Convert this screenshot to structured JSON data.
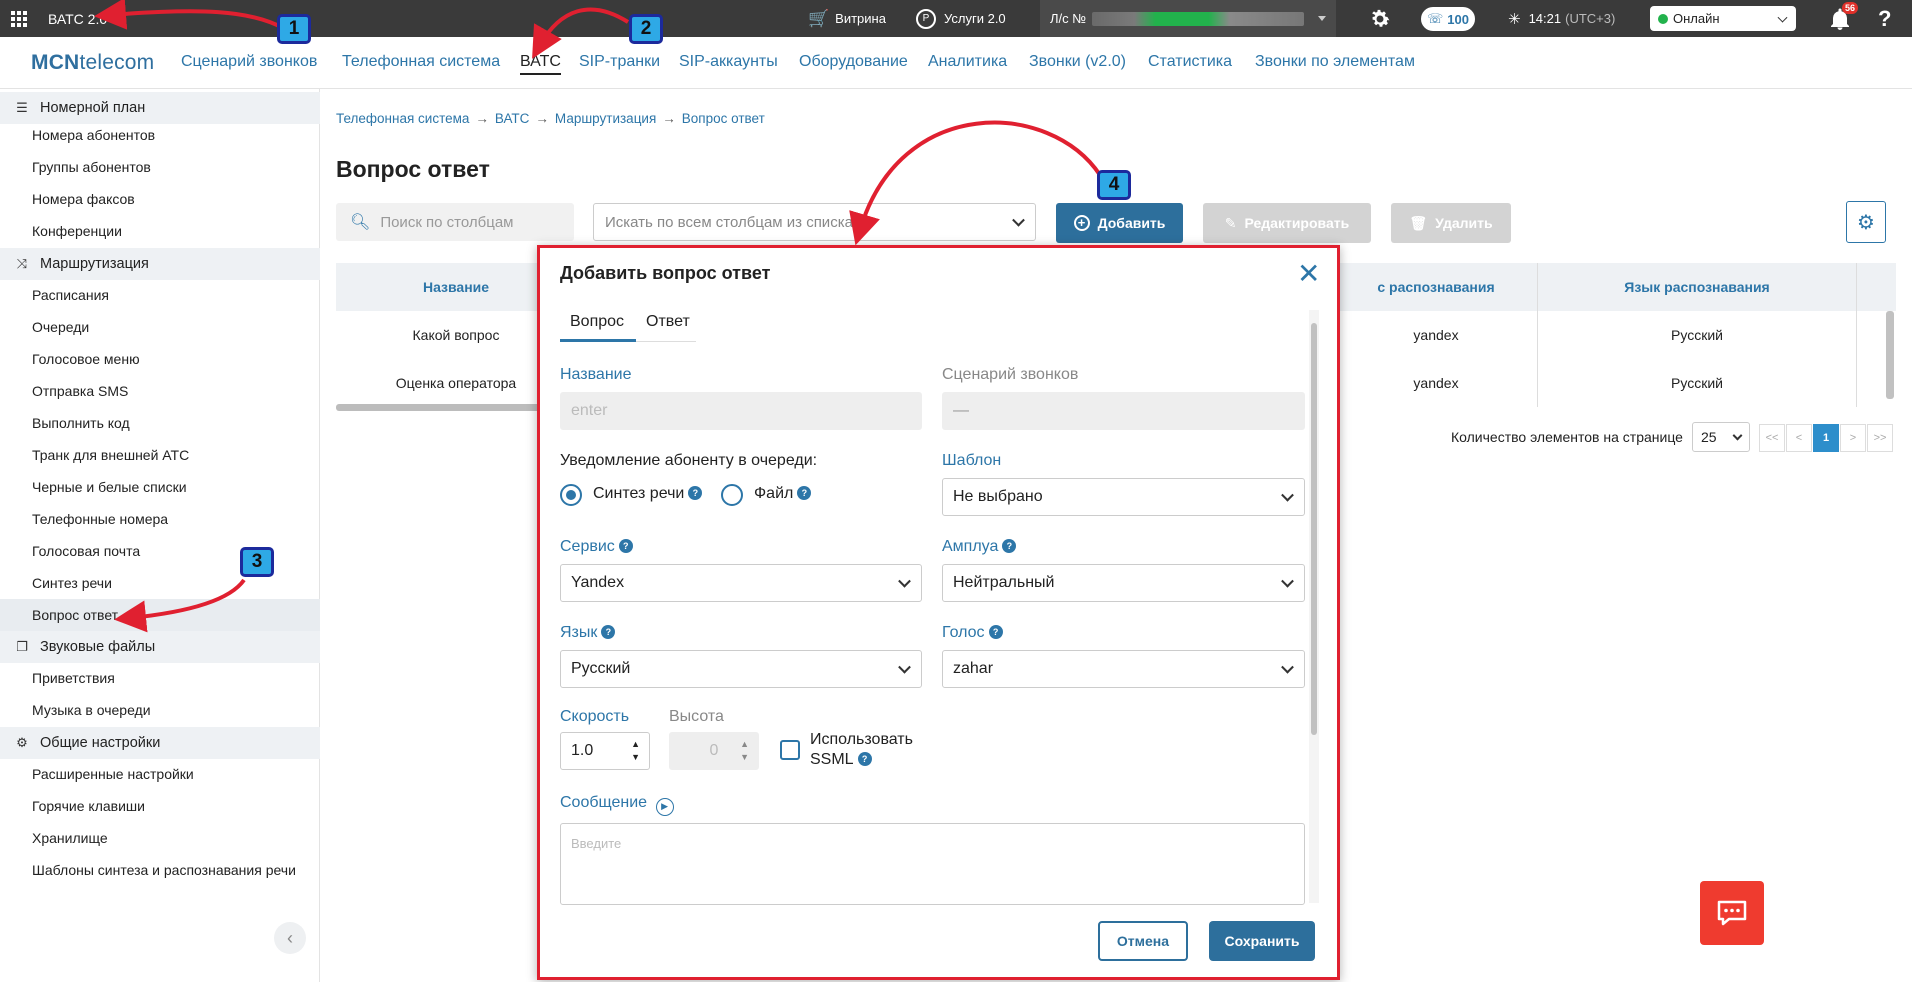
{
  "topbar": {
    "app_title": "ВАТС 2.0",
    "showcase_label": "Витрина",
    "services_label": "Услуги 2.0",
    "account_label": "Л/с №",
    "calls_count": "100",
    "time": "14:21",
    "timezone": "(UTC+3)",
    "status": "Онлайн",
    "notifications_count": "56"
  },
  "menu": {
    "logo_bold": "MCN",
    "logo_rest": "telecom",
    "items": [
      "Сценарий звонков",
      "Телефонная система",
      "ВАТС",
      "SIP-транки",
      "SIP-аккаунты",
      "Оборудование",
      "Аналитика",
      "Звонки (v2.0)",
      "Статистика",
      "Звонки по элементам"
    ],
    "active_index": 2
  },
  "sidebar": {
    "groups": [
      {
        "label": "Номерной план",
        "items": [
          "Номера абонентов",
          "Группы абонентов",
          "Номера факсов",
          "Конференции"
        ]
      },
      {
        "label": "Маршрутизация",
        "items": [
          "Расписания",
          "Очереди",
          "Голосовое меню",
          "Отправка SMS",
          "Выполнить код",
          "Транк для внешней АТС",
          "Черные и белые списки",
          "Телефонные номера",
          "Голосовая почта",
          "Синтез речи",
          "Вопрос ответ"
        ]
      },
      {
        "label": "Звуковые файлы",
        "items": [
          "Приветствия",
          "Музыка в очереди"
        ]
      },
      {
        "label": "Общие настройки",
        "items": [
          "Расширенные настройки",
          "Горячие клавиши",
          "Хранилище",
          "Шаблоны синтеза и распознавания речи"
        ]
      }
    ],
    "selected_item": "Вопрос ответ"
  },
  "breadcrumbs": [
    "Телефонная система",
    "ВАТС",
    "Маршрутизация",
    "Вопрос ответ"
  ],
  "page": {
    "title": "Вопрос ответ",
    "search_placeholder": "Поиск по столбцам",
    "column_search_placeholder": "Искать по всем столбцам из списка",
    "add_label": "Добавить",
    "edit_label": "Редактировать",
    "delete_label": "Удалить"
  },
  "table": {
    "headers": [
      "Название",
      "с распознавания",
      "Язык распознавания"
    ],
    "rows": [
      [
        "Какой вопрос",
        "yandex",
        "Русский"
      ],
      [
        "Оценка оператора",
        "yandex",
        "Русский"
      ]
    ]
  },
  "pagination": {
    "per_page_label": "Количество элементов на странице",
    "per_page": "25",
    "first": "<<",
    "prev": "<",
    "current": "1",
    "next": ">",
    "last": ">>"
  },
  "modal": {
    "title": "Добавить вопрос ответ",
    "tabs": [
      "Вопрос",
      "Ответ"
    ],
    "name_label": "Название",
    "name_placeholder": "enter",
    "scenario_label": "Сценарий звонков",
    "scenario_value": "—",
    "notify_label": "Уведомление абоненту в очереди:",
    "radio_tts": "Синтез речи",
    "radio_file": "Файл",
    "template_label": "Шаблон",
    "template_value": "Не выбрано",
    "service_label": "Сервис",
    "service_value": "Yandex",
    "role_label": "Амплуа",
    "role_value": "Нейтральный",
    "language_label": "Язык",
    "language_value": "Русский",
    "voice_label": "Голос",
    "voice_value": "zahar",
    "speed_label": "Скорость",
    "speed_value": "1.0",
    "pitch_label": "Высота",
    "pitch_value": "0",
    "ssml_label_1": "Использовать",
    "ssml_label_2": "SSML",
    "message_label": "Сообщение",
    "message_placeholder": "Введите",
    "cancel_label": "Отмена",
    "save_label": "Сохранить"
  },
  "annotations": [
    "1",
    "2",
    "3",
    "4"
  ],
  "colors": {
    "accent": "#2d76a8",
    "primary_button": "#2d6f9c",
    "topbar": "#3a3a3a",
    "highlight_border": "#e02030",
    "annotation_badge": "#2ea9e6",
    "chat_button": "#ef3b2f",
    "online_dot": "#22b24c"
  }
}
